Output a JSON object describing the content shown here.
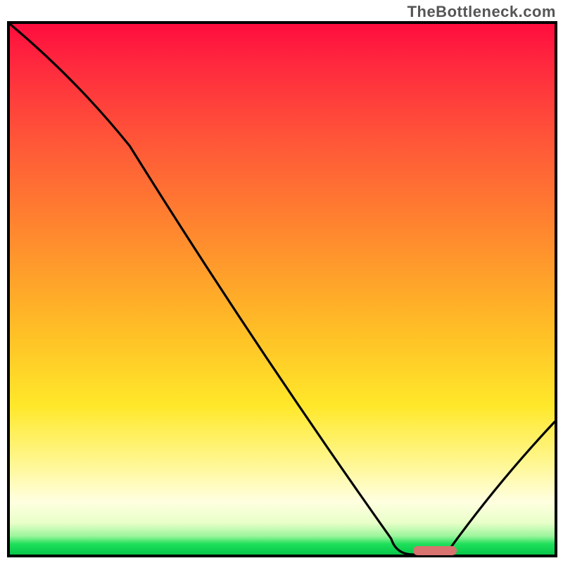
{
  "credit": "TheBottleneck.com",
  "chart_data": {
    "type": "line",
    "title": "",
    "xlabel": "",
    "ylabel": "",
    "xlim": [
      0,
      100
    ],
    "ylim": [
      0,
      100
    ],
    "series": [
      {
        "name": "curve",
        "x": [
          0,
          22,
          70,
          74,
          80,
          100
        ],
        "y": [
          100,
          77,
          3,
          0,
          0,
          25
        ]
      }
    ],
    "marker": {
      "x_start": 74,
      "x_end": 82,
      "y": 0.8
    },
    "gradient_stops": [
      {
        "pos": 0,
        "color": "#ff0d3e"
      },
      {
        "pos": 22,
        "color": "#ff5638"
      },
      {
        "pos": 50,
        "color": "#ffbf26"
      },
      {
        "pos": 80,
        "color": "#fff68a"
      },
      {
        "pos": 95,
        "color": "#9cf59c"
      },
      {
        "pos": 100,
        "color": "#07c64a"
      }
    ]
  },
  "plot": {
    "inner_w": 774,
    "inner_h": 754
  }
}
